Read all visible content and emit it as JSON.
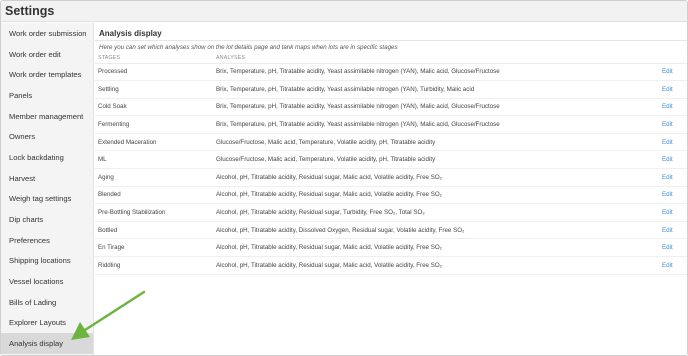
{
  "header": {
    "title": "Settings"
  },
  "sidebar": {
    "items": [
      {
        "label": "Work order submission"
      },
      {
        "label": "Work order edit"
      },
      {
        "label": "Work order templates"
      },
      {
        "label": "Panels"
      },
      {
        "label": "Member management"
      },
      {
        "label": "Owners"
      },
      {
        "label": "Lock backdating"
      },
      {
        "label": "Harvest"
      },
      {
        "label": "Weigh tag settings"
      },
      {
        "label": "Dip charts"
      },
      {
        "label": "Preferences"
      },
      {
        "label": "Shipping locations"
      },
      {
        "label": "Vessel locations"
      },
      {
        "label": "Bills of Lading"
      },
      {
        "label": "Explorer Layouts"
      },
      {
        "label": "Analysis display"
      }
    ],
    "active_index": 15
  },
  "panel": {
    "title": "Analysis display",
    "description": "Here you can set which analyses show on the lot details page and tank maps when lots are in specific stages",
    "columns": {
      "stages": "STAGES",
      "analyses": "ANALYSES"
    },
    "edit_label": "Edit",
    "rows": [
      {
        "stage": "Processed",
        "analyses": "Brix, Temperature, pH, Titratable acidity, Yeast assimilable nitrogen (YAN), Malic acid, Glucose/Fructose"
      },
      {
        "stage": "Settling",
        "analyses": "Brix, Temperature, pH, Titratable acidity, Yeast assimilable nitrogen (YAN), Turbidity, Malic acid"
      },
      {
        "stage": "Cold Soak",
        "analyses": "Brix, Temperature, pH, Titratable acidity, Yeast assimilable nitrogen (YAN), Malic acid, Glucose/Fructose"
      },
      {
        "stage": "Fermenting",
        "analyses": "Brix, Temperature, pH, Titratable acidity, Yeast assimilable nitrogen (YAN), Malic acid, Glucose/Fructose"
      },
      {
        "stage": "Extended Maceration",
        "analyses": "Glucose/Fructose, Malic acid, Temperature, Volatile acidity, pH, Titratable acidity"
      },
      {
        "stage": "ML",
        "analyses": "Glucose/Fructose, Malic acid, Temperature, Volatile acidity, pH, Titratable acidity"
      },
      {
        "stage": "Aging",
        "analyses": "Alcohol, pH, Titratable acidity, Residual sugar, Malic acid, Volatile acidity, Free SO₂"
      },
      {
        "stage": "Blended",
        "analyses": "Alcohol, pH, Titratable acidity, Residual sugar, Malic acid, Volatile acidity, Free SO₂"
      },
      {
        "stage": "Pre-Bottling Stabilization",
        "analyses": "Alcohol, pH, Titratable acidity, Residual sugar, Turbidity, Free SO₂, Total SO₂"
      },
      {
        "stage": "Bottled",
        "analyses": "Alcohol, pH, Titratable acidity, Dissolved Oxygen, Residual sugar, Volatile acidity, Free SO₂"
      },
      {
        "stage": "En Tirage",
        "analyses": "Alcohol, pH, Titratable acidity, Residual sugar, Malic acid, Volatile acidity, Free SO₂"
      },
      {
        "stage": "Riddling",
        "analyses": "Alcohol, pH, Titratable acidity, Residual sugar, Malic acid, Volatile acidity, Free SO₂"
      }
    ]
  },
  "colors": {
    "sidebar_bg": "#f4f4f4",
    "active_item_bg": "#d9d9d9",
    "link": "#3a8fd6",
    "arrow": "#6db33f"
  },
  "annotation": {
    "icon": "green-arrow-icon"
  }
}
